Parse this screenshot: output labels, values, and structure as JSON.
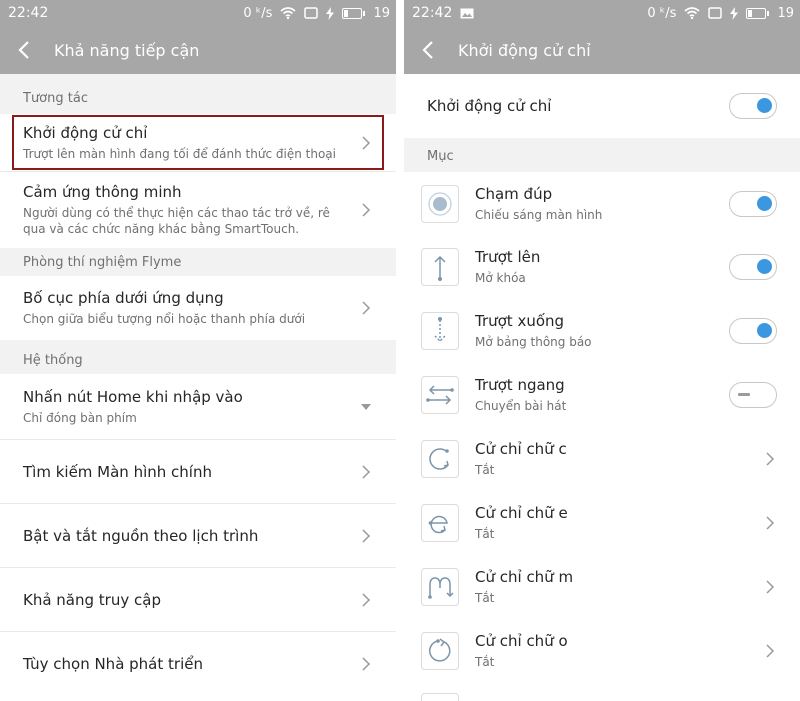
{
  "left": {
    "status": {
      "time": "22:42",
      "network": "0 ᵏ/s",
      "battery": "19"
    },
    "header": {
      "title": "Khả năng tiếp cận"
    },
    "sections": {
      "interaction": "Tương tác",
      "lab": "Phòng thí nghiệm Flyme",
      "system": "Hệ thống"
    },
    "items": [
      {
        "title": "Khởi động cử chỉ",
        "subtitle": "Trượt lên màn hình đang tối để đánh thức điện thoại"
      },
      {
        "title": "Cảm ứng thông minh",
        "subtitle": "Người dùng có thể thực hiện các thao tác trở về, rê qua và các chức năng khác bằng SmartTouch."
      },
      {
        "title": "Bố cục phía dưới ứng dụng",
        "subtitle": "Chọn giữa biểu tượng nổi hoặc thanh phía dưới"
      },
      {
        "title": "Nhấn nút Home khi nhập vào",
        "subtitle": "Chỉ đóng bàn phím"
      },
      {
        "title": "Tìm kiếm Màn hình chính"
      },
      {
        "title": "Bật và tắt nguồn theo lịch trình"
      },
      {
        "title": "Khả năng truy cập"
      },
      {
        "title": "Tùy chọn Nhà phát triển"
      }
    ]
  },
  "right": {
    "status": {
      "time": "22:42",
      "network": "0 ᵏ/s",
      "battery": "19"
    },
    "header": {
      "title": "Khởi động cử chỉ"
    },
    "master": {
      "label": "Khởi động cử chỉ",
      "on": true
    },
    "section": "Mục",
    "gestures": [
      {
        "icon": "double-tap-icon",
        "title": "Chạm đúp",
        "subtitle": "Chiếu sáng màn hình",
        "control": "toggle",
        "on": true
      },
      {
        "icon": "swipe-up-icon",
        "title": "Trượt lên",
        "subtitle": "Mở khóa",
        "control": "toggle",
        "on": true
      },
      {
        "icon": "swipe-down-icon",
        "title": "Trượt xuống",
        "subtitle": "Mở bảng thông báo",
        "control": "toggle",
        "on": true
      },
      {
        "icon": "swipe-horizontal-icon",
        "title": "Trượt ngang",
        "subtitle": "Chuyển bài hát",
        "control": "toggle",
        "on": false
      },
      {
        "icon": "gesture-c-icon",
        "title": "Cử chỉ chữ c",
        "subtitle": "Tắt",
        "control": "chevron"
      },
      {
        "icon": "gesture-e-icon",
        "title": "Cử chỉ chữ e",
        "subtitle": "Tắt",
        "control": "chevron"
      },
      {
        "icon": "gesture-m-icon",
        "title": "Cử chỉ chữ m",
        "subtitle": "Tắt",
        "control": "chevron"
      },
      {
        "icon": "gesture-o-icon",
        "title": "Cử chỉ chữ o",
        "subtitle": "Tắt",
        "control": "chevron"
      }
    ]
  },
  "colors": {
    "header": "#a7a7a7",
    "accent": "#3b98e0",
    "highlight": "#8b1a1a",
    "section_bg": "#f2f2f2"
  }
}
